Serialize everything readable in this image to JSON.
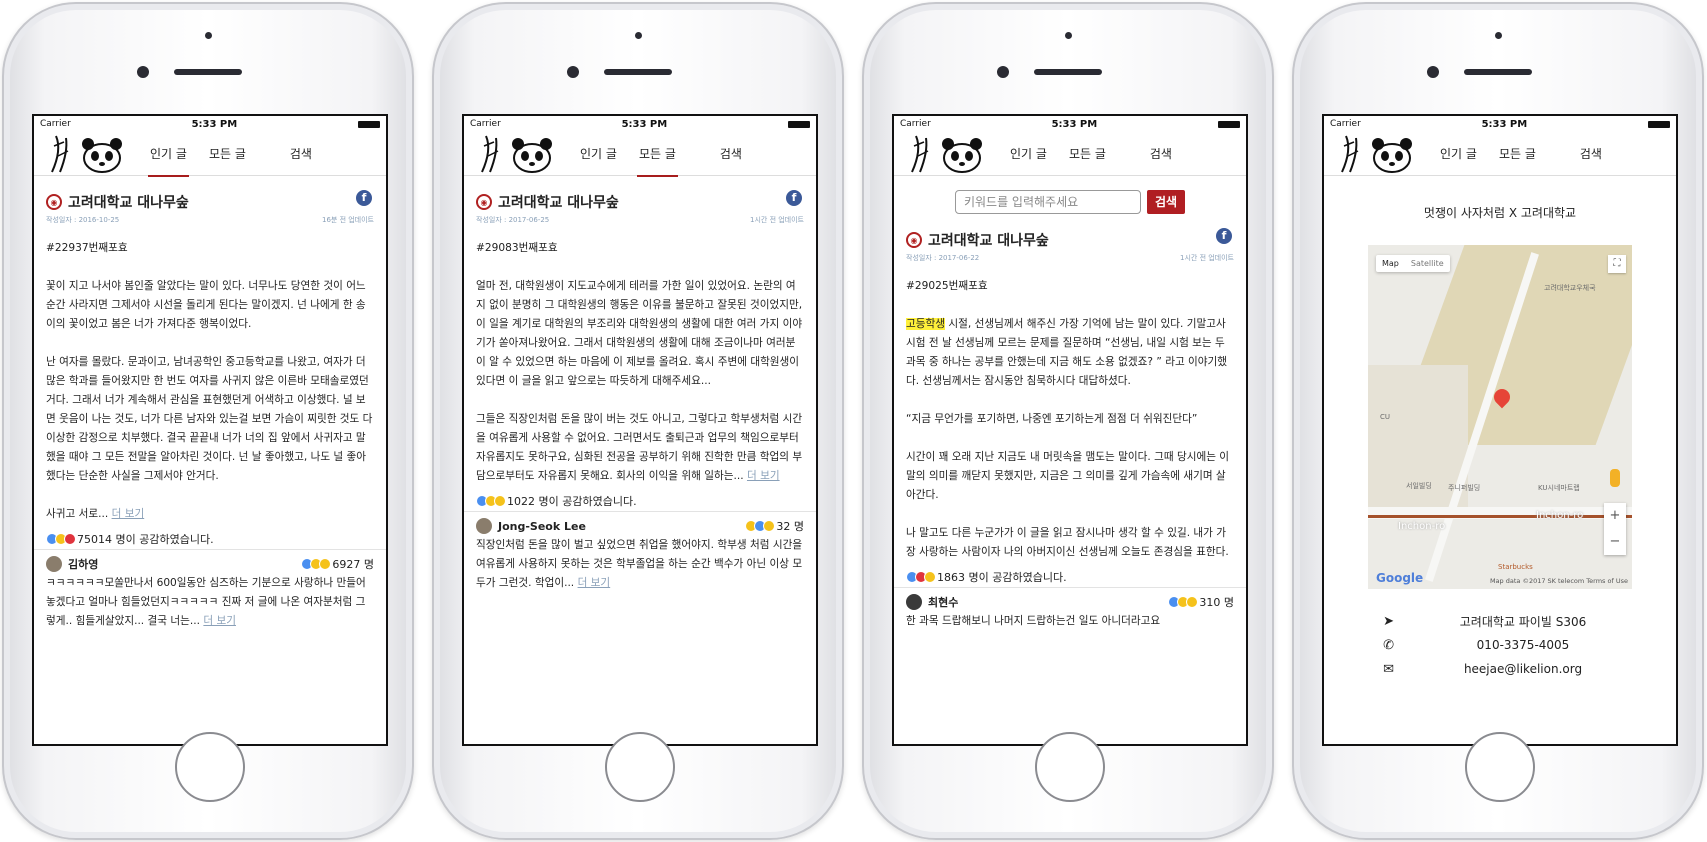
{
  "status": {
    "carrier": "Carrier",
    "time": "5:33 PM"
  },
  "nav": {
    "popular": "인기 글",
    "all": "모든 글",
    "search": "검색"
  },
  "page": {
    "name": "고려대학교 대나무숲"
  },
  "screen1": {
    "date": "작성일자 : 2016-10-25",
    "updated": "16분 전 업데이트",
    "post_no": "#22937번째포효",
    "paragraphs": [
      "꽃이 지고 나서야 봄인줄 알았다는 말이 있다. 너무나도 당연한 것이 어느순간 사라지면 그제서야 시선을 돌리게 된다는 말이겠지. 넌 나에게 한 송이의 꽃이었고 봄은 너가 가져다준 행복이었다.",
      "난 여자를 몰랐다. 문과이고, 남녀공학인 중고등학교를 나왔고, 여자가 더 많은 학과를 들어왔지만 한 번도 여자를 사귀지 않은 이른바 모태솔로였던거다. 그래서 너가 계속해서 관심을 표현했던게 어색하고 이상했다. 널 보면 웃음이 나는 것도, 너가 다른 남자와 있는걸 보면 가슴이 찌릿한 것도 다 이상한 감정으로 치부했다. 결국 끝끝내 너가 너의 집 앞에서 사귀자고 말했을 때야 그 모든 전말을 알아차린 것이다. 넌 날 좋아했고, 나도 널 좋아했다는 단순한 사실을 그제서야 안거다."
    ],
    "tail": "사귀고 서로...",
    "more": "더 보기",
    "likes": "75014 명이 공감하였습니다.",
    "comment": {
      "author": "김하영",
      "count": "6927 명",
      "text": "ㅋㅋㅋㅋㅋㅋ모쏠만나서 600일동안 심즈하는 기분으로 사랑하나 만들어놓겠다고 얼마나 힘들었던지ㅋㅋㅋㅋㅋ 진짜 저 글에 나온 여자분처럼 그렇게.. 힘들게살았지... 결국 너는...",
      "more": "더 보기"
    }
  },
  "screen2": {
    "date": "작성일자 : 2017-06-25",
    "updated": "1시간 전 업데이트",
    "post_no": "#29083번째포효",
    "p1": "얼마 전, 대학원생이 지도교수에게 테러를 가한 일이 있었어요. 논란의 여지 없이 분명히 그 대학원생의 행동은 이유를 불문하고 잘못된 것이었지만, 이 일을 계기로 대학원의 부조리와 대학원생의 생활에 대한 여러 가지 이야기가 쏟아져나왔어요. 그래서 대학원생의 생활에 대해 조금이나마 여러분이 알 수 있었으면 하는 마음에 이 제보를 올려요. 혹시 주변에 대학원생이 있다면 이 글을 읽고 앞으로는 따듯하게 대해주세요...",
    "p2": "그들은 직장인처럼 돈을 많이 버는 것도 아니고, 그렇다고 학부생처럼 시간을 여유롭게 사용할 수 없어요. 그러면서도 출퇴근과 업무의 책임으로부터 자유롭지도 못하구요, 심화된 전공을 공부하기 위해 진학한 만큼 학업의 부담으로부터도 자유롭지 못해요. 회사의 이익을 위해 일하는...",
    "more": "더 보기",
    "likes": "1022 명이 공감하였습니다.",
    "comment": {
      "author": "Jong-Seok Lee",
      "count": "32 명",
      "text": "직장인처럼 돈을 많이 벌고 싶었으면 취업을 했어야지. 학부생 처럼 시간을 여유롭게 사용하지 못하는 것은 학부졸업을 하는 순간 백수가 아닌 이상 모두가 그런것. 학업이...",
      "more": "더 보기"
    }
  },
  "screen3": {
    "search_placeholder": "키워드를 입력해주세요",
    "search_button": "검색",
    "date": "작성일자 : 2017-06-22",
    "updated": "1시간 전 업데이트",
    "post_no": "#29025번째포효",
    "highlight": "고등학생",
    "p1_rest": " 시절, 선생님께서 해주신 가장 기억에 남는 말이 있다. 기말고사 시험 전 날 선생님께 모르는 문제를 질문하며 “선생님, 내일 시험 보는 두 과목 중 하나는 공부를 안했는데 지금 해도 소용 없겠죠? ” 라고 이야기했다. 선생님께서는 잠시동안 침묵하시다 대답하셨다.",
    "p2": "“지금 무언가를 포기하면, 나중엔 포기하는게 점점 더 쉬워진단다”",
    "p3": "시간이 꽤 오래 지난 지금도 내 머릿속을 맴도는 말이다. 그때 당시에는 이 말의 의미를 깨닫지 못했지만, 지금은 그 의미를 깊게 가슴속에 새기며 살아간다.",
    "p4": "나 말고도 다른 누군가가 이 글을 읽고 잠시나마 생각 할 수 있길. 내가 가장 사랑하는 사람이자 나의 아버지이신 선생님께 오늘도 존경심을 표한다.",
    "likes": "1863 명이 공감하였습니다.",
    "comment": {
      "author": "최현수",
      "count": "310 명",
      "text": "한 과목 드랍해보니 나머지 드랍하는건 일도 아니더라고요"
    }
  },
  "screen4": {
    "title": "멋쟁이 사자처럼 X 고려대학교",
    "map": {
      "map_btn": "Map",
      "satellite_btn": "Satellite",
      "google": "Google",
      "attribution": "Map data ©2017 SK telecom   Terms of Use",
      "labels": [
        "Inchon-ro",
        "Inchon-ro",
        "CU",
        "Starbucks",
        "서일빌딩",
        "주니퍼빌딩",
        "KU시네마트랩",
        "고려대학교우체국"
      ]
    },
    "address": "고려대학교 파이빌 S306",
    "phone": "010-3375-4005",
    "email": "heejae@likelion.org"
  }
}
